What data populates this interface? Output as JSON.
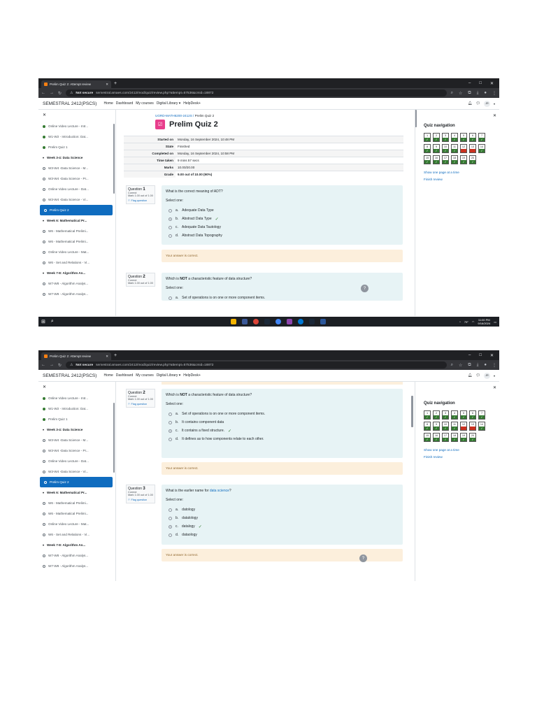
{
  "browser": {
    "tab_title": "Prelim Quiz 2: Attempt review",
    "not_secure": "Not secure",
    "url": "semestral.amaes.com/2412/mod/quiz/review.php?attempt=57536&cmid=18872"
  },
  "header": {
    "site": "SEMESTRAL 2412(PSCS)",
    "menu": [
      "Home",
      "Dashboard",
      "My courses",
      "Digital Library ▾",
      "HelpDesk+"
    ],
    "avatar": "JR"
  },
  "drawer1": [
    {
      "label": "Online Video Lecture - Intr...",
      "state": "done"
    },
    {
      "label": "W1-W2 - Introduction: Dat...",
      "state": "done"
    },
    {
      "label": "Prelim Quiz 1",
      "state": "done"
    },
    {
      "label": "Week 3-4: Data Science",
      "state": "section"
    },
    {
      "label": "W3-W4 -Data Science - M...",
      "state": "todo"
    },
    {
      "label": "W3-W4 -Data Science - Pr...",
      "state": "todo"
    },
    {
      "label": "Online Video Lecture - Dat...",
      "state": "todo"
    },
    {
      "label": "W3-W4 -Data Science - Vi...",
      "state": "todo"
    },
    {
      "label": "Prelim Quiz 2",
      "state": "active"
    },
    {
      "label": "Week 6: Mathematical Pr...",
      "state": "section"
    },
    {
      "label": "W6 - Mathematical Prelimi...",
      "state": "todo"
    },
    {
      "label": "W6 - Mathematical Prelimi...",
      "state": "todo"
    },
    {
      "label": "Online Video Lecture - Mat...",
      "state": "todo"
    },
    {
      "label": "W6 - Set and Relations - Vi...",
      "state": "todo"
    },
    {
      "label": "Week 7-8: Algorithm An...",
      "state": "section"
    },
    {
      "label": "W7-W8 - Algorithm Analys...",
      "state": "todo"
    },
    {
      "label": "W7-W8 - Algorithm Analys...",
      "state": "todo"
    }
  ],
  "breadcrumb": {
    "course": "UGRD-MATH6200-2412S",
    "current": "Prelim Quiz 2"
  },
  "quiz_title": "Prelim Quiz 2",
  "summary": [
    {
      "k": "Started on",
      "v": "Monday, 16 September 2024, 10:48 PM"
    },
    {
      "k": "State",
      "v": "Finished"
    },
    {
      "k": "Completed on",
      "v": "Monday, 16 September 2024, 10:58 PM"
    },
    {
      "k": "Time taken",
      "v": "9 mins 57 secs"
    },
    {
      "k": "Marks",
      "v": "10.00/20.00"
    },
    {
      "k": "Grade",
      "v": "9.00 out of 10.00 (90%)"
    }
  ],
  "q_common": {
    "status": "Correct",
    "mark": "Mark 1.00 out of 1.00",
    "flag": "Flag question",
    "select_one": "Select one:",
    "feedback": "Your answer is correct."
  },
  "question1": {
    "label": "Question",
    "num": "1",
    "text": "What is the correct meaning of ADT?",
    "options": [
      {
        "letter": "a.",
        "text": "Adequate Data Type"
      },
      {
        "letter": "b.",
        "text": "Abstract Data Type",
        "selected": true
      },
      {
        "letter": "c.",
        "text": "Adequate Data Tautology"
      },
      {
        "letter": "d.",
        "text": "Abstract Data Topography"
      }
    ]
  },
  "question2": {
    "label": "Question",
    "num": "2",
    "text_pre": "Which is ",
    "text_bold": "NOT",
    "text_post": " a characteristic feature of data structure?",
    "options": [
      {
        "letter": "a.",
        "text": "Set of operations is on one or more component items."
      },
      {
        "letter": "b.",
        "text": "It contains component data"
      },
      {
        "letter": "c.",
        "text": "It contains a fixed structure.",
        "selected": true
      },
      {
        "letter": "d.",
        "text": "It defines as to how components  relate to each other."
      }
    ]
  },
  "question3": {
    "label": "Question",
    "num": "3",
    "text_pre": "What is the earlier name for ",
    "text_kw": "data science",
    "text_post": "?",
    "options": [
      {
        "letter": "a.",
        "text": "datology"
      },
      {
        "letter": "b.",
        "text": "datalology"
      },
      {
        "letter": "c.",
        "text": "datalogy",
        "selected": true
      },
      {
        "letter": "d.",
        "text": "dataology"
      }
    ]
  },
  "quiz_nav": {
    "title": "Quiz navigation",
    "cells": [
      {
        "n": "1",
        "r": "correct"
      },
      {
        "n": "2",
        "r": "correct"
      },
      {
        "n": "3",
        "r": "correct"
      },
      {
        "n": "4",
        "r": "correct"
      },
      {
        "n": "5",
        "r": "correct"
      },
      {
        "n": "6",
        "r": "correct"
      },
      {
        "n": "7",
        "r": "correct"
      },
      {
        "n": "8",
        "r": "correct"
      },
      {
        "n": "9",
        "r": "correct"
      },
      {
        "n": "10",
        "r": "correct"
      },
      {
        "n": "11",
        "r": "correct"
      },
      {
        "n": "12",
        "r": "wrong"
      },
      {
        "n": "13",
        "r": "wrong"
      },
      {
        "n": "14",
        "r": "correct"
      },
      {
        "n": "15",
        "r": "correct"
      },
      {
        "n": "16",
        "r": "correct"
      },
      {
        "n": "17",
        "r": "correct"
      },
      {
        "n": "18",
        "r": "correct"
      },
      {
        "n": "19",
        "r": "correct"
      },
      {
        "n": "20",
        "r": "correct"
      }
    ],
    "show_one": "Show one page at a time",
    "finish": "Finish review"
  },
  "taskbar": {
    "time": "11:00 PM",
    "date": "9/16/2024",
    "weather": "79°"
  },
  "colors": {
    "correct": "#357a32",
    "wrong": "#ca3120",
    "accent": "#0f6cbf"
  }
}
